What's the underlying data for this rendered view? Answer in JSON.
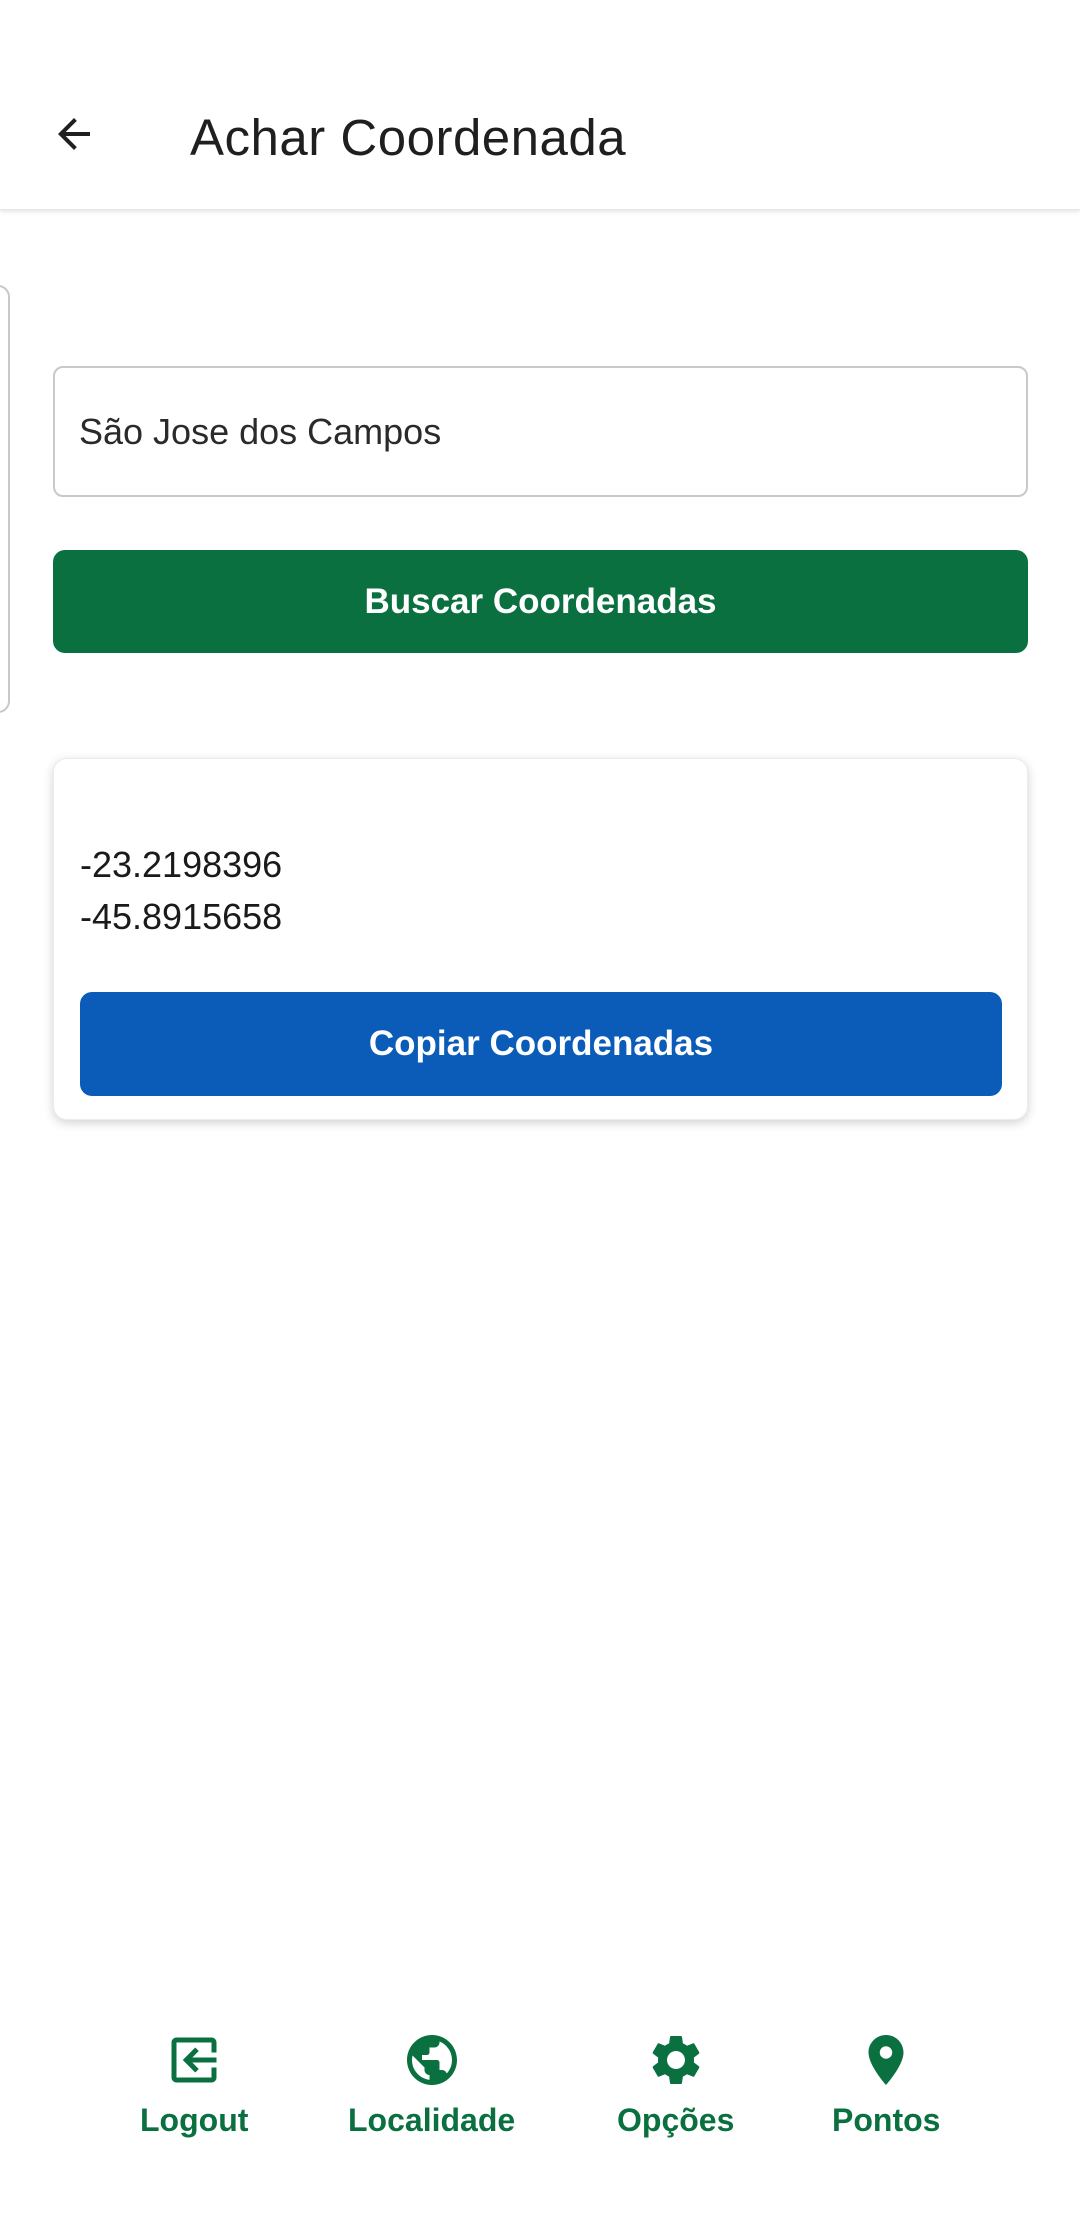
{
  "header": {
    "title": "Achar Coordenada",
    "back_icon": "arrow-left-icon"
  },
  "search": {
    "value": "São Jose dos Campos",
    "button_label": "Buscar Coordenadas"
  },
  "result": {
    "latitude": "-23.2198396",
    "longitude": "-45.8915658",
    "copy_label": "Copiar Coordenadas"
  },
  "bottom_nav": {
    "items": [
      {
        "label": "Logout",
        "icon": "logout-icon"
      },
      {
        "label": "Localidade",
        "icon": "globe-icon"
      },
      {
        "label": "Opções",
        "icon": "gear-icon"
      },
      {
        "label": "Pontos",
        "icon": "map-pin-icon"
      }
    ]
  },
  "colors": {
    "primary_green": "#0a7040",
    "primary_blue": "#0a5cb8"
  }
}
